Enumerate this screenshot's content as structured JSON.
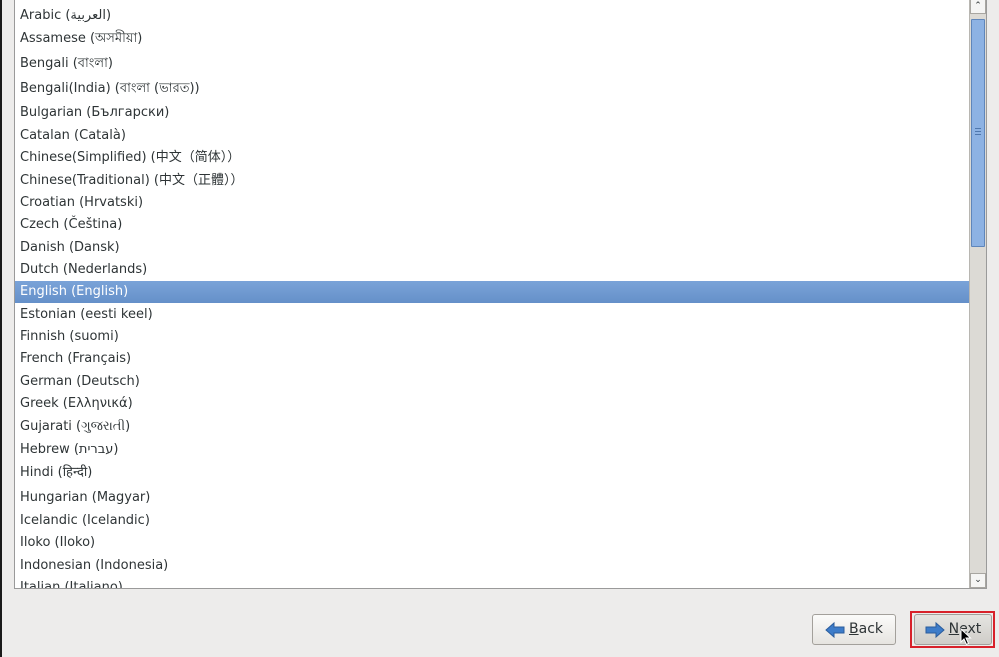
{
  "language_list": {
    "items": [
      {
        "label": "Arabic (العربية)",
        "selected": false
      },
      {
        "label": "Assamese (অসমীয়া)",
        "selected": false
      },
      {
        "label": "Bengali (বাংলা)",
        "selected": false
      },
      {
        "label": "Bengali(India) (বাংলা (ভারত))",
        "selected": false
      },
      {
        "label": "Bulgarian (Български)",
        "selected": false
      },
      {
        "label": "Catalan (Català)",
        "selected": false
      },
      {
        "label": "Chinese(Simplified) (中文（简体））",
        "selected": false
      },
      {
        "label": "Chinese(Traditional) (中文（正體））",
        "selected": false
      },
      {
        "label": "Croatian (Hrvatski)",
        "selected": false
      },
      {
        "label": "Czech (Čeština)",
        "selected": false
      },
      {
        "label": "Danish (Dansk)",
        "selected": false
      },
      {
        "label": "Dutch (Nederlands)",
        "selected": false
      },
      {
        "label": "English (English)",
        "selected": true
      },
      {
        "label": "Estonian (eesti keel)",
        "selected": false
      },
      {
        "label": "Finnish (suomi)",
        "selected": false
      },
      {
        "label": "French (Français)",
        "selected": false
      },
      {
        "label": "German (Deutsch)",
        "selected": false
      },
      {
        "label": "Greek (Ελληνικά)",
        "selected": false
      },
      {
        "label": "Gujarati (ગુજરાતી)",
        "selected": false
      },
      {
        "label": "Hebrew (עברית)",
        "selected": false
      },
      {
        "label": "Hindi (हिन्दी)",
        "selected": false
      },
      {
        "label": "Hungarian (Magyar)",
        "selected": false
      },
      {
        "label": "Icelandic (Icelandic)",
        "selected": false
      },
      {
        "label": "Iloko (Iloko)",
        "selected": false
      },
      {
        "label": "Indonesian (Indonesia)",
        "selected": false
      },
      {
        "label": "Italian (Italiano)",
        "selected": false
      }
    ]
  },
  "scrollbar": {
    "up_icon": "chevron-up-icon",
    "down_icon": "chevron-down-icon",
    "up_glyph": "⌃",
    "down_glyph": "⌄"
  },
  "buttons": {
    "back": {
      "mnemonic": "B",
      "rest": "ack",
      "icon": "arrow-left-icon"
    },
    "next": {
      "mnemonic": "N",
      "rest": "ext",
      "icon": "arrow-right-icon"
    }
  },
  "colors": {
    "selection": "#6d97cf",
    "highlight_outline": "#d8212a",
    "arrow": "#3d7cc9"
  }
}
